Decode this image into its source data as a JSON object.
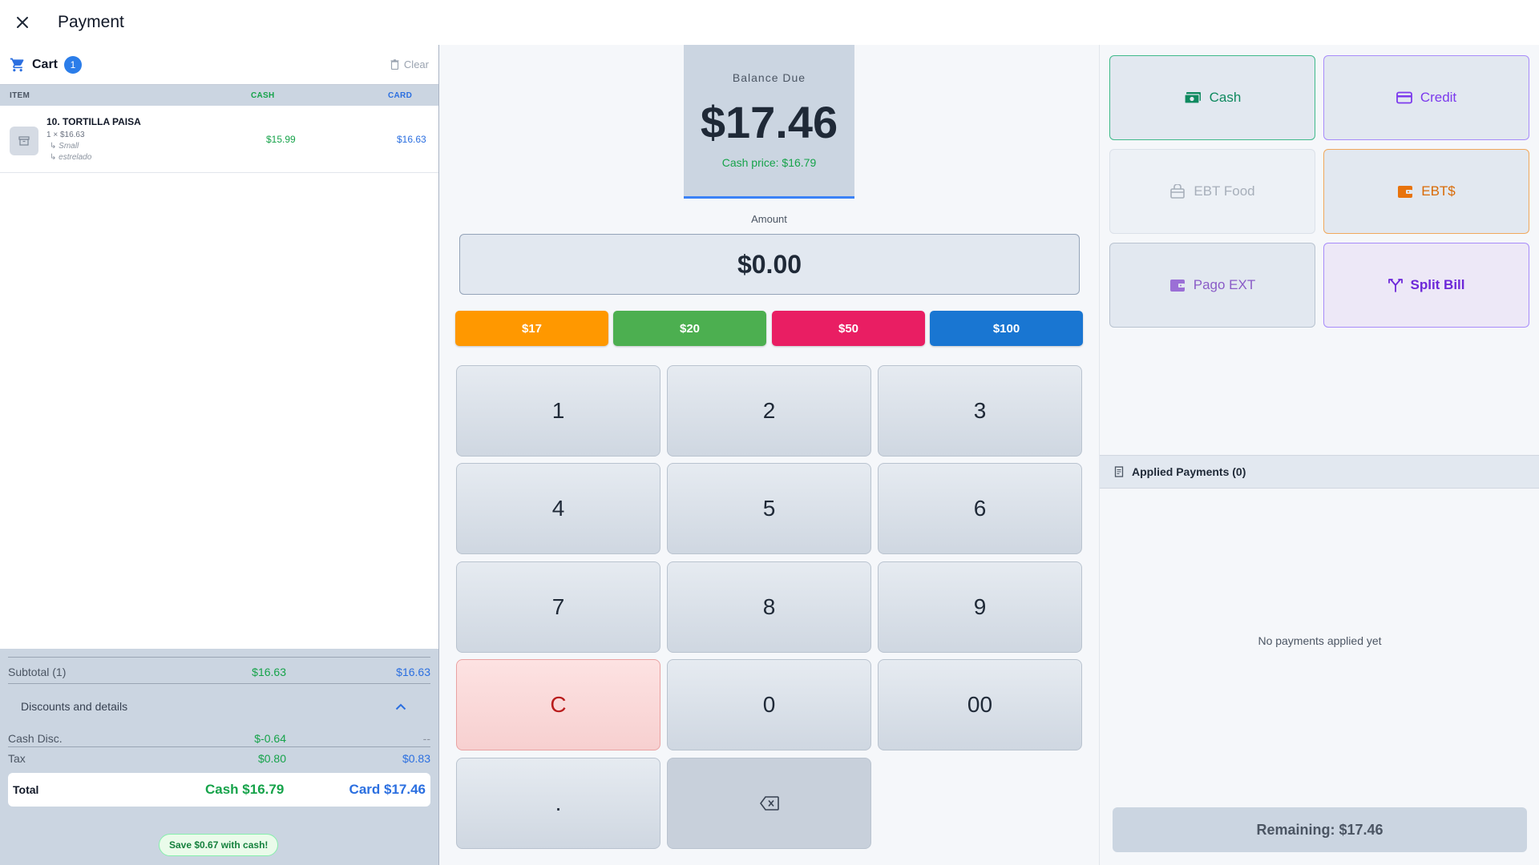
{
  "header": {
    "title": "Payment"
  },
  "cart": {
    "title": "Cart",
    "count": "1",
    "clear_label": "Clear",
    "columns": {
      "item": "ITEM",
      "cash": "CASH",
      "card": "CARD"
    },
    "items": [
      {
        "name": "10. TORTILLA PAISA",
        "qty_line": "1 × $16.63",
        "modifiers": [
          "↳ Small",
          "↳ estrelado"
        ],
        "cash": "$15.99",
        "card": "$16.63"
      }
    ]
  },
  "summary": {
    "subtotal": {
      "label": "Subtotal (1)",
      "cash": "$16.63",
      "card": "$16.63"
    },
    "discounts_label": "Discounts and details",
    "cash_disc": {
      "label": "Cash Disc.",
      "cash": "$-0.64",
      "card": "--"
    },
    "tax": {
      "label": "Tax",
      "cash": "$0.80",
      "card": "$0.83"
    },
    "total": {
      "label": "Total",
      "cash": "Cash $16.79",
      "card": "Card $17.46"
    },
    "save_note": "Save $0.67 with cash!"
  },
  "balance": {
    "label": "Balance Due",
    "value": "$17.46",
    "cash_price": "Cash price: $16.79"
  },
  "amount": {
    "label": "Amount",
    "value": "$0.00"
  },
  "quick_amounts": [
    {
      "label": "$17",
      "color": "#ff9800"
    },
    {
      "label": "$20",
      "color": "#4caf50"
    },
    {
      "label": "$50",
      "color": "#e91e63"
    },
    {
      "label": "$100",
      "color": "#1976d2"
    }
  ],
  "keypad": [
    "1",
    "2",
    "3",
    "4",
    "5",
    "6",
    "7",
    "8",
    "9",
    "C",
    "0",
    "00",
    "."
  ],
  "methods": {
    "cash": "Cash",
    "credit": "Credit",
    "ebt_food": "EBT Food",
    "ebt_cash": "EBT$",
    "pago_ext": "Pago EXT",
    "split_bill": "Split Bill"
  },
  "applied": {
    "title": "Applied Payments (0)",
    "empty": "No payments applied yet",
    "remaining": "Remaining: $17.46"
  }
}
